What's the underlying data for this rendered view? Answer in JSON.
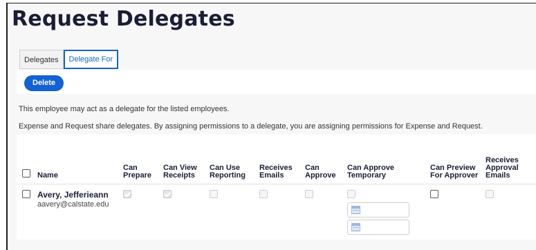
{
  "page": {
    "title": "Request Delegates"
  },
  "tabs": [
    {
      "label": "Delegates",
      "active": false
    },
    {
      "label": "Delegate For",
      "active": true
    }
  ],
  "toolbar": {
    "delete_label": "Delete"
  },
  "info": {
    "line1": "This employee may act as a delegate for the listed employees.",
    "line2": "Expense and Request share delegates. By assigning permissions to a delegate, you are assigning permissions for Expense and Request."
  },
  "table": {
    "headers": {
      "name": "Name",
      "can_prepare": "Can Prepare",
      "can_view_receipts": "Can View Receipts",
      "can_use_reporting": "Can Use Reporting",
      "receives_emails": "Receives Emails",
      "can_approve": "Can Approve",
      "can_approve_temporary": "Can Approve Temporary",
      "can_preview_for_approver": "Can Preview For Approver",
      "receives_approval_emails": "Receives Approval Emails"
    },
    "rows": [
      {
        "name": "Avery, Jefferieann",
        "email": "aavery@calstate.edu",
        "can_prepare": true,
        "can_view_receipts": true,
        "can_use_reporting": false,
        "receives_emails": false,
        "can_approve": false,
        "can_approve_temporary": false,
        "can_preview_for_approver": false,
        "receives_approval_emails": false
      }
    ]
  },
  "icons": {
    "date": "calendar-icon"
  },
  "colors": {
    "accent": "#1262d4",
    "title": "#1b1d38"
  }
}
